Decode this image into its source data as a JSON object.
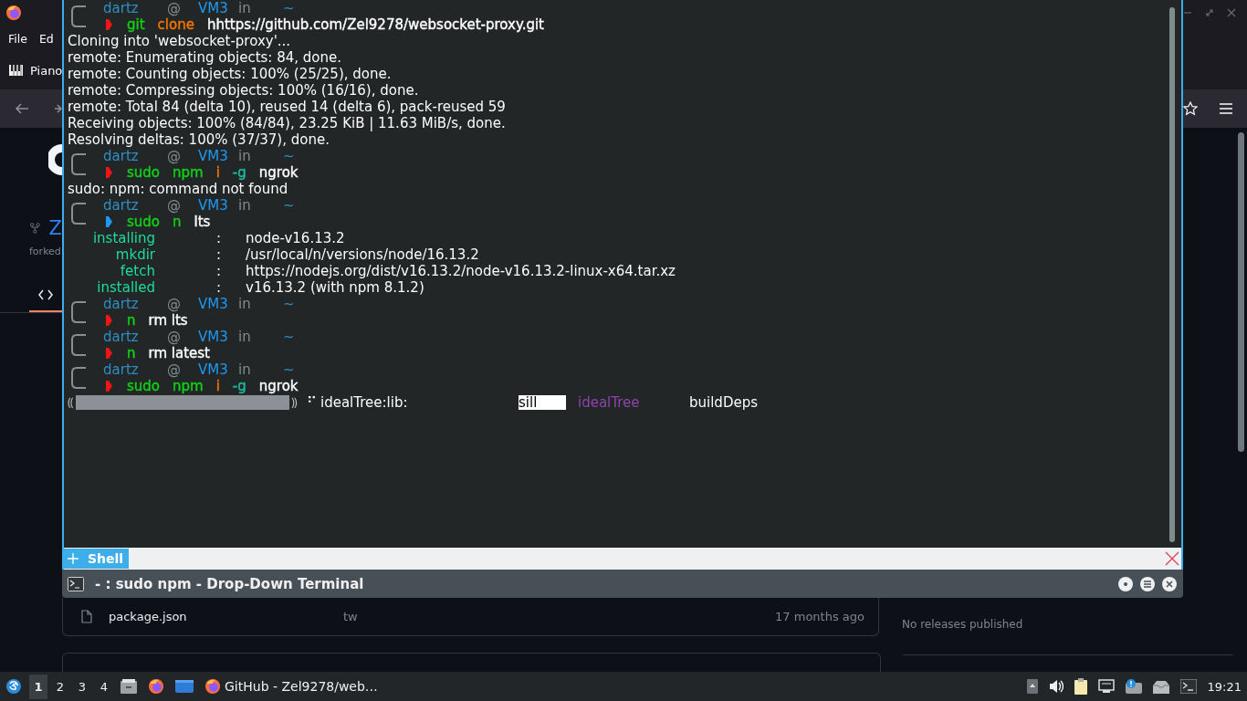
{
  "browser": {
    "menu": [
      "File",
      "Ed"
    ],
    "bookmark": "Piano",
    "repo_initial": "Z",
    "forked_label": "forked",
    "files": [
      {
        "name": "package.json",
        "commit": "tw",
        "age": "17 months ago"
      }
    ],
    "releases": "No releases published"
  },
  "terminal": {
    "lines": [
      {
        "kind": "prompt",
        "user": "dartz",
        "at": "@",
        "host": "VM3",
        "in": "in",
        "dir": "~",
        "color": "#ed1515",
        "command": [
          {
            "text": "git",
            "color": "#11d116"
          },
          {
            "text": "clone",
            "color": "#f67400"
          },
          {
            "text": "hhttps://github.com/Zel9278/websocket-proxy.git",
            "color": "#fcfcfc"
          }
        ]
      },
      {
        "kind": "output",
        "text": "Cloning into 'websocket-proxy'..."
      },
      {
        "kind": "output",
        "text": "remote: Enumerating objects: 84, done."
      },
      {
        "kind": "output",
        "text": "remote: Counting objects: 100% (25/25), done."
      },
      {
        "kind": "output",
        "text": "remote: Compressing objects: 100% (16/16), done."
      },
      {
        "kind": "output",
        "text": "remote: Total 84 (delta 10), reused 14 (delta 6), pack-reused 59"
      },
      {
        "kind": "output",
        "text": "Receiving objects: 100% (84/84), 23.25 KiB | 11.63 MiB/s, done."
      },
      {
        "kind": "output",
        "text": "Resolving deltas: 100% (37/37), done."
      },
      {
        "kind": "prompt",
        "user": "dartz",
        "at": "@",
        "host": "VM3",
        "in": "in",
        "dir": "~",
        "color": "#ed1515",
        "command": [
          {
            "text": "sudo",
            "color": "#11d116"
          },
          {
            "text": "npm",
            "color": "#11d116"
          },
          {
            "text": "i",
            "color": "#f67400"
          },
          {
            "text": "-g",
            "color": "#1abc9c"
          },
          {
            "text": "ngrok",
            "color": "#fcfcfc"
          }
        ]
      },
      {
        "kind": "output",
        "text": "sudo: npm: command not found"
      },
      {
        "kind": "prompt",
        "user": "dartz",
        "at": "@",
        "host": "VM3",
        "in": "in",
        "dir": "~",
        "color": "#1d99f3",
        "command": [
          {
            "text": "sudo",
            "color": "#11d116"
          },
          {
            "text": "n",
            "color": "#11d116"
          },
          {
            "text": "lts",
            "color": "#fcfcfc"
          }
        ]
      },
      {
        "kind": "field",
        "label": "installing",
        "sep": ":",
        "value": "node-v16.13.2"
      },
      {
        "kind": "field",
        "label": "mkdir",
        "sep": ":",
        "value": "/usr/local/n/versions/node/16.13.2"
      },
      {
        "kind": "field",
        "label": "fetch",
        "sep": ":",
        "value": "https://nodejs.org/dist/v16.13.2/node-v16.13.2-linux-x64.tar.xz"
      },
      {
        "kind": "field",
        "label": "installed",
        "sep": ":",
        "value": "v16.13.2 (with npm 8.1.2)"
      },
      {
        "kind": "prompt",
        "user": "dartz",
        "at": "@",
        "host": "VM3",
        "in": "in",
        "dir": "~",
        "color": "#ed1515",
        "command": [
          {
            "text": "n",
            "color": "#11d116"
          },
          {
            "text": "rm lts",
            "color": "#fcfcfc"
          }
        ]
      },
      {
        "kind": "prompt",
        "user": "dartz",
        "at": "@",
        "host": "VM3",
        "in": "in",
        "dir": "~",
        "color": "#ed1515",
        "command": [
          {
            "text": "n",
            "color": "#11d116"
          },
          {
            "text": "rm latest",
            "color": "#fcfcfc"
          }
        ]
      },
      {
        "kind": "prompt",
        "user": "dartz",
        "at": "@",
        "host": "VM3",
        "in": "in",
        "dir": "~",
        "color": "#ed1515",
        "command": [
          {
            "text": "sudo",
            "color": "#11d116"
          },
          {
            "text": "npm",
            "color": "#11d116"
          },
          {
            "text": "i",
            "color": "#f67400"
          },
          {
            "text": "-g",
            "color": "#1abc9c"
          },
          {
            "text": "ngrok",
            "color": "#fcfcfc"
          }
        ]
      },
      {
        "kind": "progress",
        "open": "⸨",
        "close": "⸩",
        "spinner": "⠋",
        "stage": "idealTree:lib:",
        "log_level": "sill",
        "section": "idealTree",
        "message": "buildDeps"
      }
    ],
    "tab": {
      "label": "Shell",
      "selected": true
    },
    "title": "- : sudo npm - Drop-Down Terminal"
  },
  "taskbar": {
    "desktops": [
      {
        "label": "1",
        "selected": true
      },
      {
        "label": "2",
        "selected": false
      },
      {
        "label": "3",
        "selected": false
      },
      {
        "label": "4",
        "selected": false
      }
    ],
    "task": "GitHub - Zel9278/web…",
    "clock": "19:21"
  }
}
